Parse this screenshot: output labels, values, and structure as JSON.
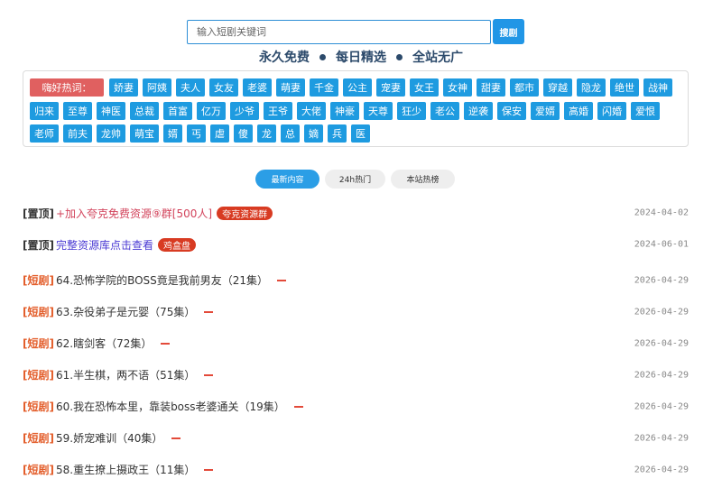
{
  "search": {
    "placeholder": "输入短剧关键词",
    "button_label": "搜剧"
  },
  "slogan": [
    "永久免费",
    "每日精选",
    "全站无广"
  ],
  "hot": {
    "label": "嗨好热词：",
    "row1": [
      "娇妻",
      "阿姨",
      "夫人",
      "女友",
      "老婆",
      "萌妻",
      "千金",
      "公主",
      "宠妻",
      "女王",
      "女神",
      "甜妻",
      "都市",
      "穿越",
      "隐龙",
      "绝世",
      "战神"
    ],
    "row2": [
      "归来",
      "至尊",
      "神医",
      "总裁",
      "首富",
      "亿万",
      "少爷",
      "王爷",
      "大佬",
      "神豪",
      "天尊",
      "狂少",
      "老公",
      "逆袭",
      "保安",
      "爱婿",
      "高婚",
      "闪婚",
      "爱恨"
    ],
    "row3": [
      "老师",
      "前夫",
      "龙帅",
      "萌宝",
      "婿",
      "丐",
      "虐",
      "傻",
      "龙",
      "总",
      "嫡",
      "兵",
      "医"
    ]
  },
  "tabs": [
    {
      "label": "最新内容",
      "active": true
    },
    {
      "label": "24h热门",
      "active": false
    },
    {
      "label": "本站热榜",
      "active": false
    }
  ],
  "list": [
    {
      "tag": "[置顶]",
      "tag_type": "pin",
      "title": "+加入夸克免费资源⑨群[500人]",
      "title_style": "red",
      "badge": "夸克资源群",
      "date": "2024-04-02"
    },
    {
      "tag": "[置顶]",
      "tag_type": "pin",
      "title": "完整资源库点击查看",
      "title_style": "blue",
      "badge": "鸡盒盘",
      "date": "2024-06-01"
    },
    {
      "tag": "[短剧]",
      "tag_type": "short",
      "title": "64.恐怖学院的BOSS竟是我前男友（21集）",
      "title_style": "plain",
      "date": "2026-04-29"
    },
    {
      "tag": "[短剧]",
      "tag_type": "short",
      "title": "63.杂役弟子是元婴（75集）",
      "title_style": "plain",
      "date": "2026-04-29"
    },
    {
      "tag": "[短剧]",
      "tag_type": "short",
      "title": "62.瞎剑客（72集）",
      "title_style": "plain",
      "date": "2026-04-29"
    },
    {
      "tag": "[短剧]",
      "tag_type": "short",
      "title": "61.半生棋，两不语（51集）",
      "title_style": "plain",
      "date": "2026-04-29"
    },
    {
      "tag": "[短剧]",
      "tag_type": "short",
      "title": "60.我在恐怖本里，靠装boss老婆通关（19集）",
      "title_style": "plain",
      "date": "2026-04-29"
    },
    {
      "tag": "[短剧]",
      "tag_type": "short",
      "title": "59.娇宠难训（40集）",
      "title_style": "plain",
      "date": "2026-04-29"
    },
    {
      "tag": "[短剧]",
      "tag_type": "short",
      "title": "58.重生撩上摄政王（11集）",
      "title_style": "plain",
      "date": "2026-04-29"
    }
  ],
  "colors": {
    "accent": "#2196e6",
    "hot_label": "#e06060",
    "tag_bg": "#1e9be0",
    "short_tag": "#e35d2a",
    "badge_red": "#d83b22"
  }
}
